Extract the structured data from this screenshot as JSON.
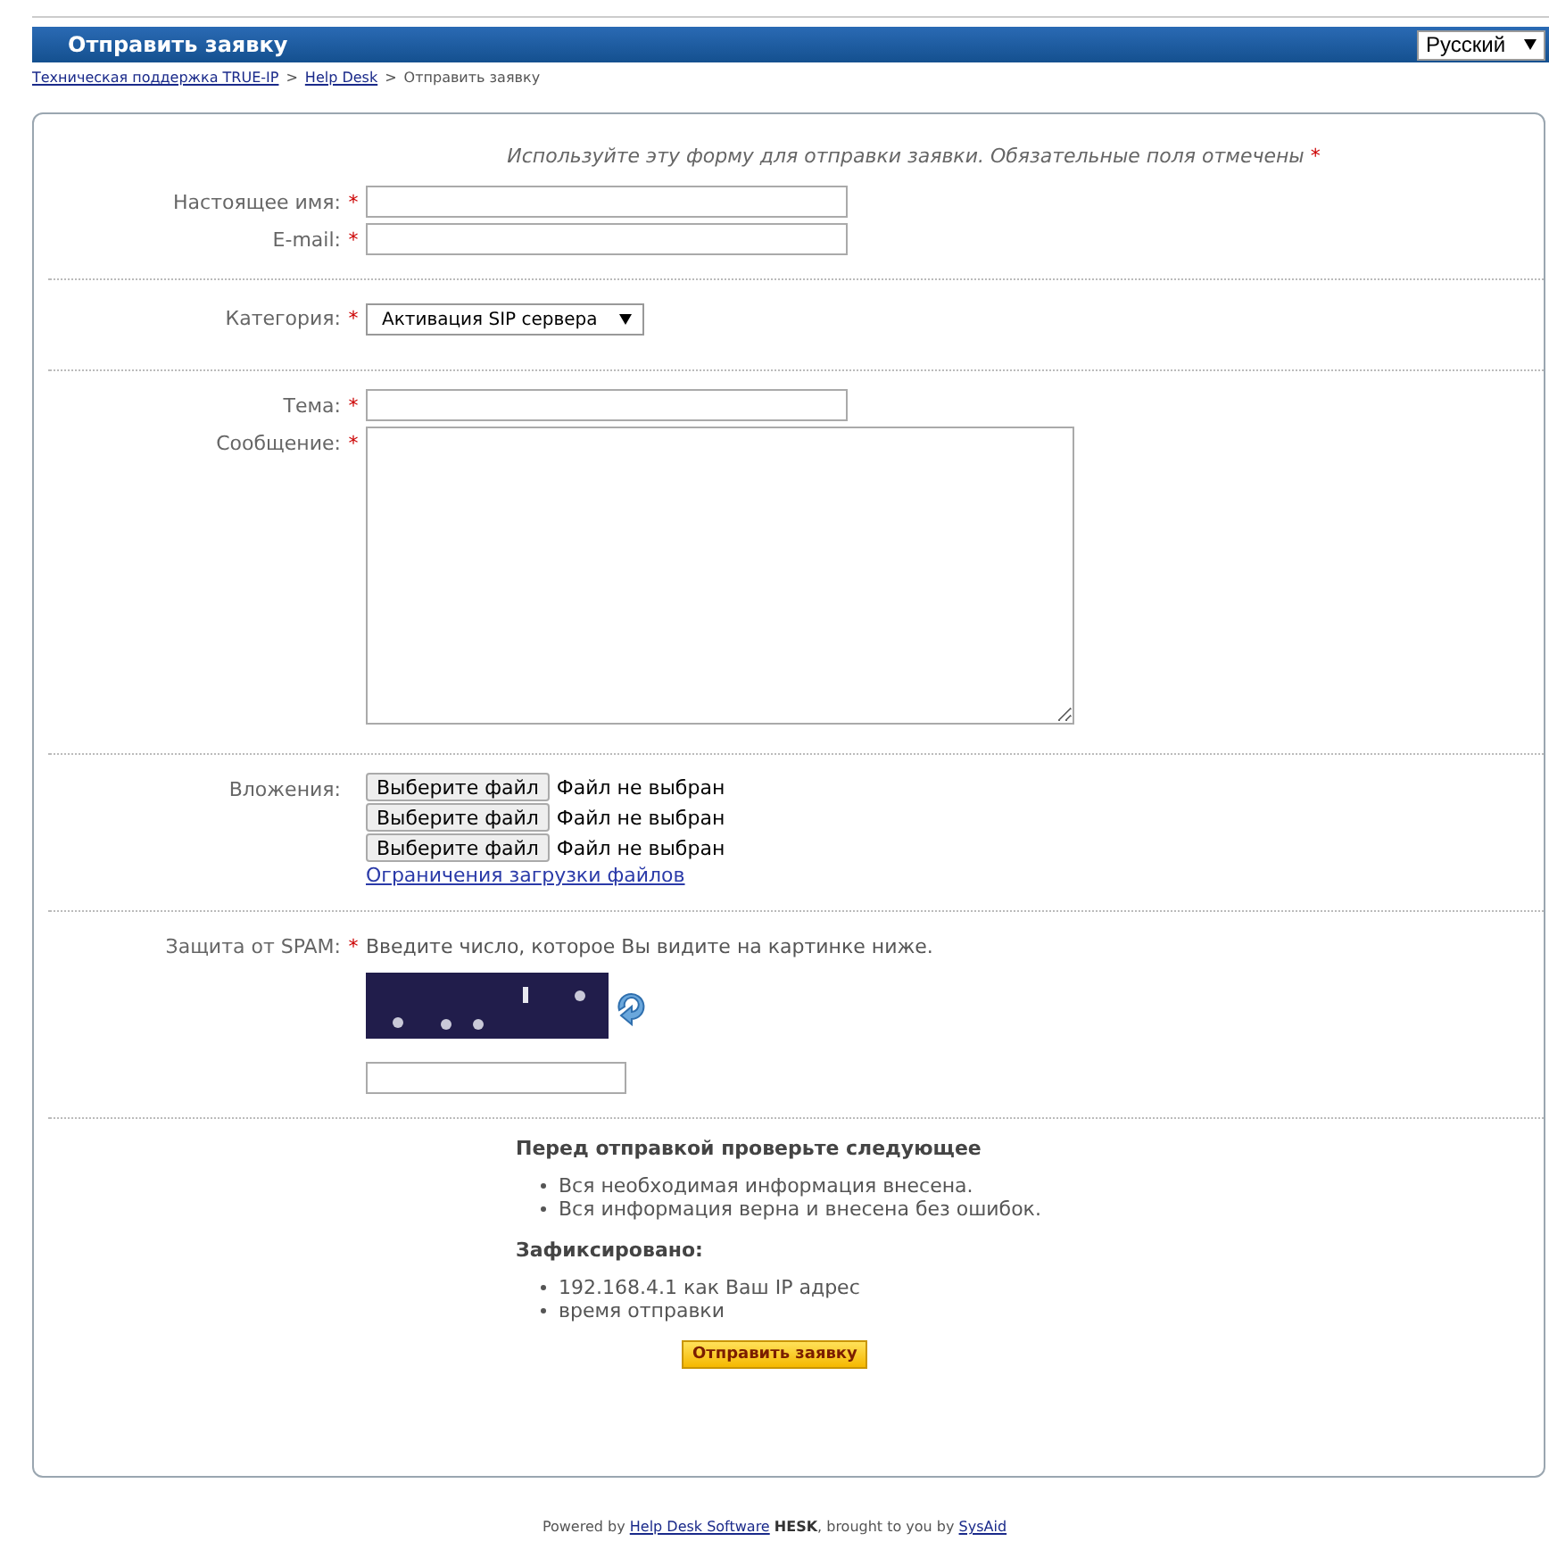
{
  "header": {
    "title": "Отправить заявку",
    "language": "Русский"
  },
  "breadcrumb": [
    {
      "label": "Техническая поддержка TRUE-IP",
      "link": true
    },
    {
      "label": "Help Desk",
      "link": true
    },
    {
      "label": "Отправить заявку",
      "link": false
    }
  ],
  "breadcrumb_separator": ">",
  "required_mark": "*",
  "intro": "Используйте эту форму для отправки заявки. Обязательные поля отмечены",
  "sections": [
    {
      "rows": [
        {
          "kind": "text",
          "label": "Настоящее имя:",
          "required": true
        },
        {
          "kind": "text",
          "label": "E-mail:",
          "required": true
        }
      ]
    },
    {
      "rows": [
        {
          "kind": "select",
          "label": "Категория:",
          "required": true,
          "value": "Активация SIP сервера"
        }
      ]
    },
    {
      "rows": [
        {
          "kind": "text",
          "label": "Тема:",
          "required": true
        },
        {
          "kind": "textarea",
          "label": "Сообщение:",
          "required": true
        }
      ]
    },
    {
      "rows": [
        {
          "kind": "files",
          "label": "Вложения:",
          "required": false,
          "files": [
            {
              "button": "Выберите файл",
              "status": "Файл не выбран"
            },
            {
              "button": "Выберите файл",
              "status": "Файл не выбран"
            },
            {
              "button": "Выберите файл",
              "status": "Файл не выбран"
            }
          ],
          "limits_link": "Ограничения загрузки файлов"
        }
      ]
    },
    {
      "rows": [
        {
          "kind": "captcha",
          "label": "Защита от SPAM:",
          "required": true,
          "hint": "Введите число, которое Вы видите на картинке ниже."
        }
      ]
    }
  ],
  "checklist": {
    "title": "Перед отправкой проверьте следующее",
    "items": [
      "Вся необходимая информация внесена.",
      "Вся информация верна и внесена без ошибок."
    ]
  },
  "recorded": {
    "title": "Зафиксировано:",
    "items": [
      "192.168.4.1 как Ваш IP адрес",
      "время отправки"
    ]
  },
  "submit": "Отправить заявку",
  "footer": {
    "prefix": "Powered by",
    "link1": "Help Desk Software",
    "brand": "HESK",
    "middle": ", brought to you by",
    "link2": "SysAid"
  }
}
